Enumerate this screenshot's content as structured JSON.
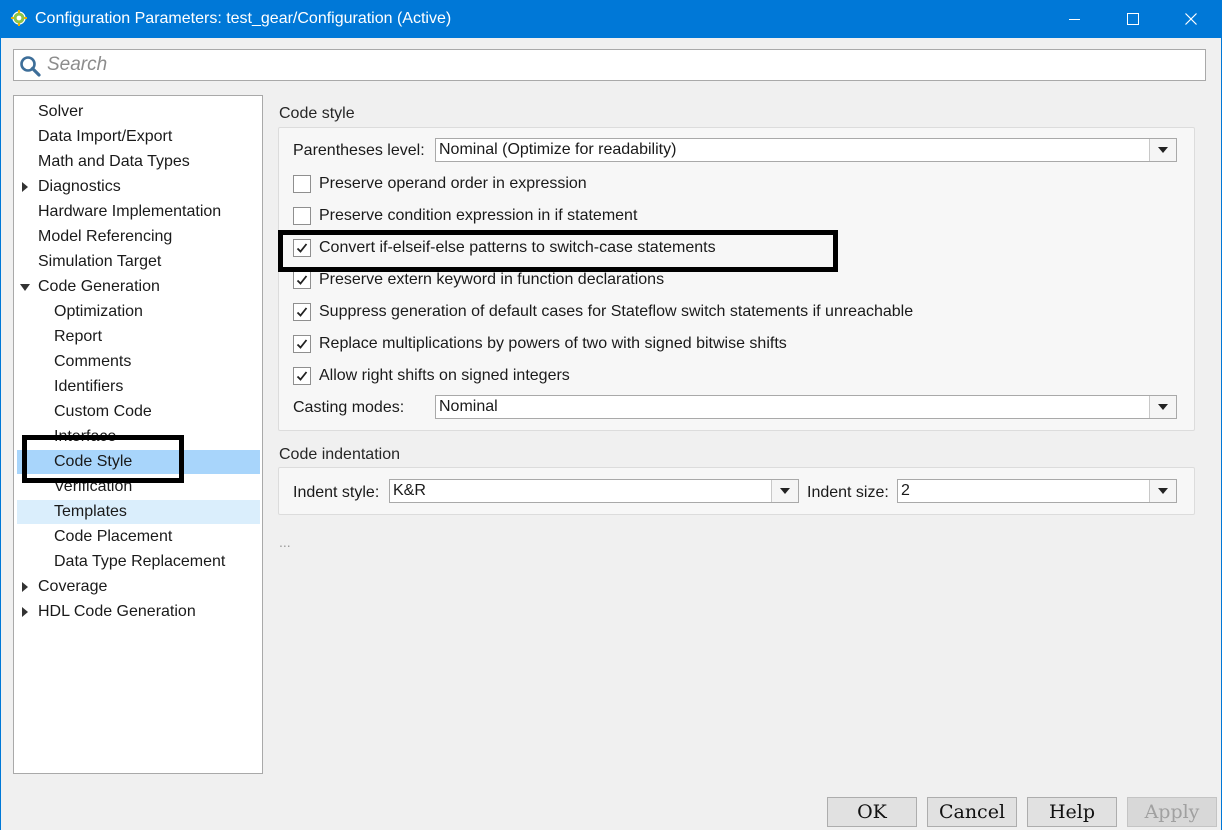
{
  "window": {
    "title": "Configuration Parameters: test_gear/Configuration (Active)",
    "controls": [
      "minimize-icon",
      "maximize-icon",
      "close-icon"
    ]
  },
  "search": {
    "placeholder": "Search"
  },
  "tree": {
    "items": [
      {
        "label": "Solver"
      },
      {
        "label": "Data Import/Export"
      },
      {
        "label": "Math and Data Types"
      },
      {
        "label": "Diagnostics",
        "expander": "collapsed"
      },
      {
        "label": "Hardware Implementation"
      },
      {
        "label": "Model Referencing"
      },
      {
        "label": "Simulation Target"
      },
      {
        "label": "Code Generation",
        "expander": "expanded"
      },
      {
        "label": "Optimization"
      },
      {
        "label": "Report"
      },
      {
        "label": "Comments"
      },
      {
        "label": "Identifiers"
      },
      {
        "label": "Custom Code"
      },
      {
        "label": "Interface"
      },
      {
        "label": "Code Style",
        "state": "selected"
      },
      {
        "label": "Verification"
      },
      {
        "label": "Templates",
        "state": "hover"
      },
      {
        "label": "Code Placement"
      },
      {
        "label": "Data Type Replacement"
      },
      {
        "label": "Coverage",
        "expander": "collapsed"
      },
      {
        "label": "HDL Code Generation",
        "expander": "collapsed"
      }
    ]
  },
  "code_style": {
    "title": "Code style",
    "parentheses_label": "Parentheses level:",
    "parentheses_value": "Nominal (Optimize for readability)",
    "checkboxes": [
      {
        "label": "Preserve operand order in expression",
        "checked": false
      },
      {
        "label": "Preserve condition expression in if statement",
        "checked": false
      },
      {
        "label": "Convert if-elseif-else patterns to switch-case statements",
        "checked": true
      },
      {
        "label": "Preserve extern keyword in function declarations",
        "checked": true
      },
      {
        "label": "Suppress generation of default cases for Stateflow switch statements if unreachable",
        "checked": true
      },
      {
        "label": "Replace multiplications by powers of two with signed bitwise shifts",
        "checked": true
      },
      {
        "label": "Allow right shifts on signed integers",
        "checked": true
      }
    ],
    "casting_label": "Casting modes:",
    "casting_value": "Nominal"
  },
  "code_indentation": {
    "title": "Code indentation",
    "indent_style_label": "Indent style:",
    "indent_style_value": "K&R",
    "indent_size_label": "Indent size:",
    "indent_size_value": "2"
  },
  "more": "...",
  "buttons": {
    "ok": "OK",
    "cancel": "Cancel",
    "help": "Help",
    "apply": "Apply"
  },
  "colors": {
    "titlebar": "#0078d7",
    "selection": "#a8d5fb",
    "hover": "#daeefc",
    "annotation": "#000000"
  }
}
